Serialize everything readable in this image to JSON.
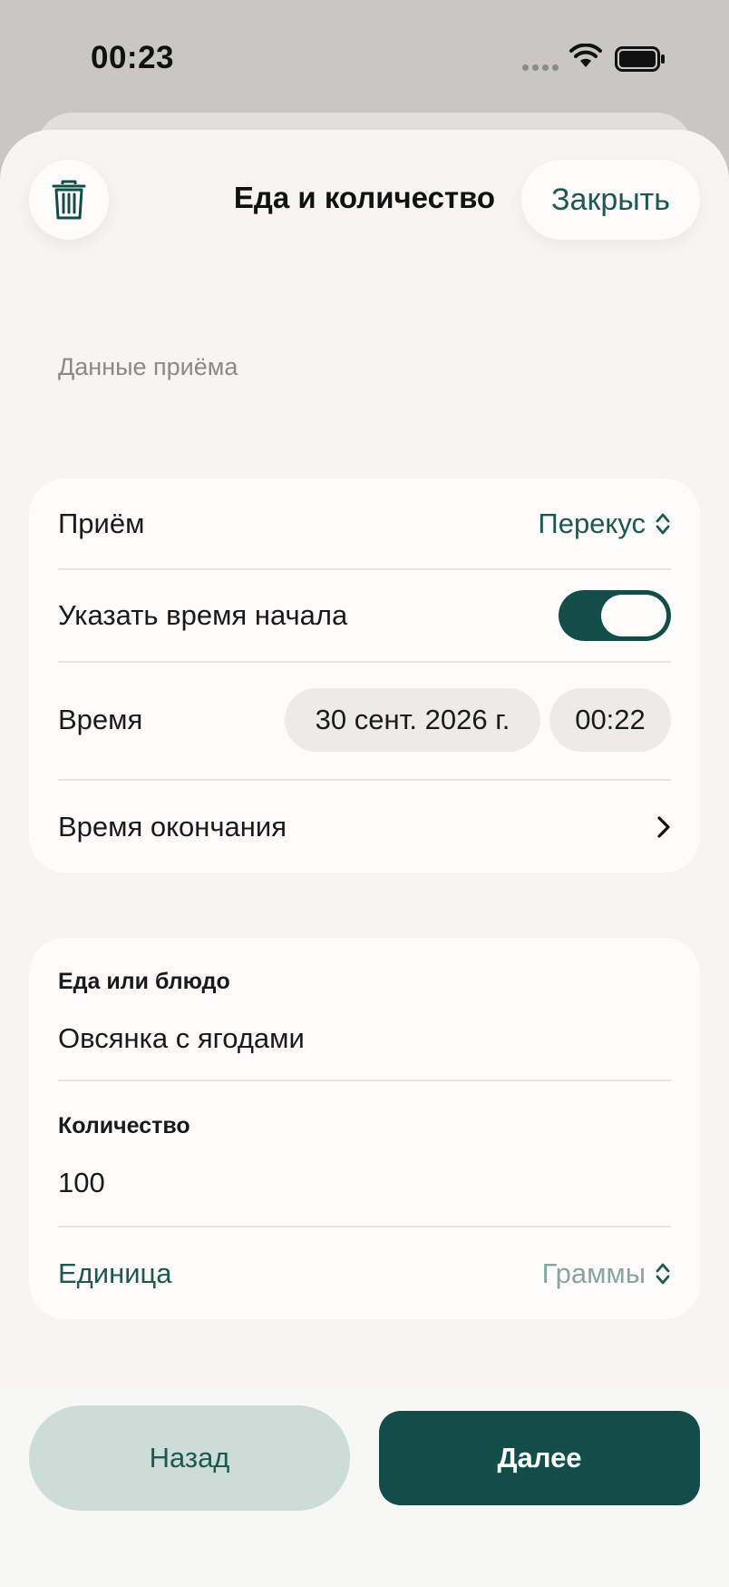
{
  "status_bar": {
    "time": "00:23"
  },
  "header": {
    "title": "Еда и количество",
    "close_label": "Закрыть"
  },
  "section": {
    "title": "Данные приёма"
  },
  "meal_card": {
    "meal_label": "Приём",
    "meal_value": "Перекус",
    "start_time_label": "Указать время начала",
    "start_time_enabled": true,
    "time_label": "Время",
    "date_value": "30 сент. 2026 г.",
    "time_value": "00:22",
    "end_time_label": "Время окончания"
  },
  "food_card": {
    "food_label": "Еда или блюдо",
    "food_value": "Овсянка с ягодами",
    "quantity_label": "Количество",
    "quantity_value": "100",
    "unit_label": "Единица",
    "unit_value": "Граммы"
  },
  "footer": {
    "back_label": "Назад",
    "next_label": "Далее"
  },
  "colors": {
    "accent": "#124d4a",
    "accent_text": "#1f5752",
    "sheet": "#f6f5f1",
    "card": "#fdfcfa"
  },
  "icons": [
    "trash-icon",
    "chevron-updown-icon",
    "chevron-right-icon",
    "wifi-icon",
    "battery-icon"
  ]
}
